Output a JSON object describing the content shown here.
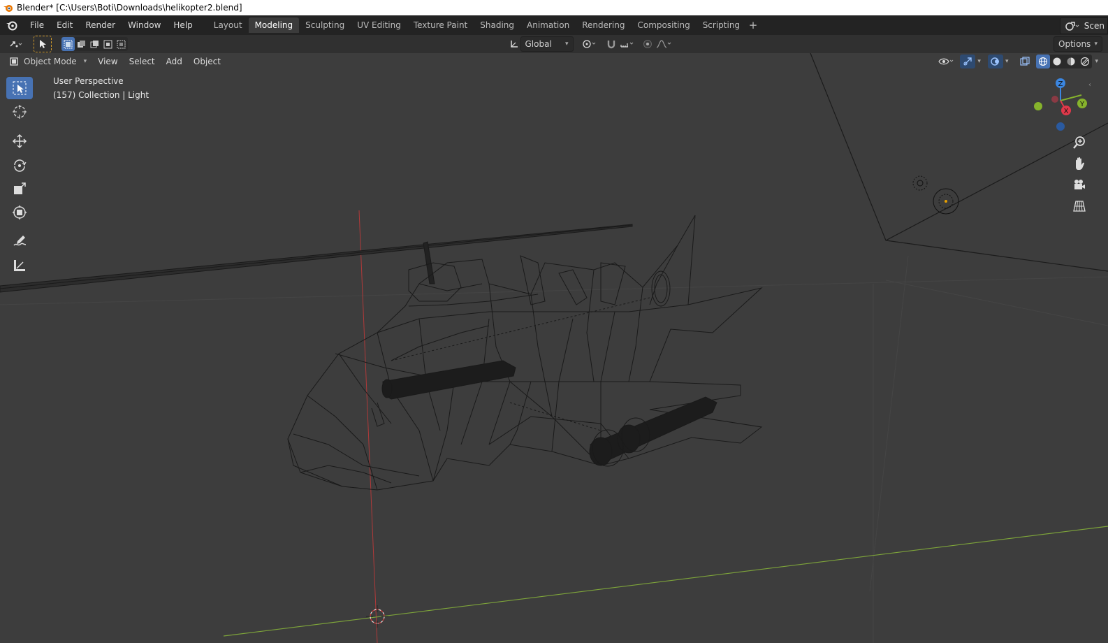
{
  "window": {
    "title": "Blender* [C:\\Users\\Boti\\Downloads\\helikopter2.blend]"
  },
  "menubar": {
    "items": [
      "File",
      "Edit",
      "Render",
      "Window",
      "Help"
    ]
  },
  "workspaces": {
    "tabs": [
      "Layout",
      "Modeling",
      "Sculpting",
      "UV Editing",
      "Texture Paint",
      "Shading",
      "Animation",
      "Rendering",
      "Compositing",
      "Scripting"
    ],
    "active": "Modeling",
    "add_label": "+"
  },
  "scene": {
    "label": "Scen"
  },
  "toolheader": {
    "orientation": "Global",
    "options_label": "Options"
  },
  "viewport_header": {
    "mode": "Object Mode",
    "menus": [
      "View",
      "Select",
      "Add",
      "Object"
    ]
  },
  "viewport": {
    "perspective_label": "User Perspective",
    "collection_label": "(157) Collection | Light",
    "background_color": "#3d3d3d",
    "grid_color": "#4a4a4a",
    "x_axis_color": "#b03a3a",
    "y_axis_color": "#7ea53a",
    "active_tool_color": "#4772b3"
  },
  "gizmo": {
    "z": "Z",
    "y": "Y",
    "x": "X",
    "z_color": "#3b86e0",
    "y_color": "#86b32c",
    "x_color": "#e0384a"
  },
  "toolbar": {
    "tools": [
      "select-box",
      "cursor",
      "move",
      "rotate",
      "scale",
      "transform",
      "annotate",
      "measure"
    ]
  }
}
